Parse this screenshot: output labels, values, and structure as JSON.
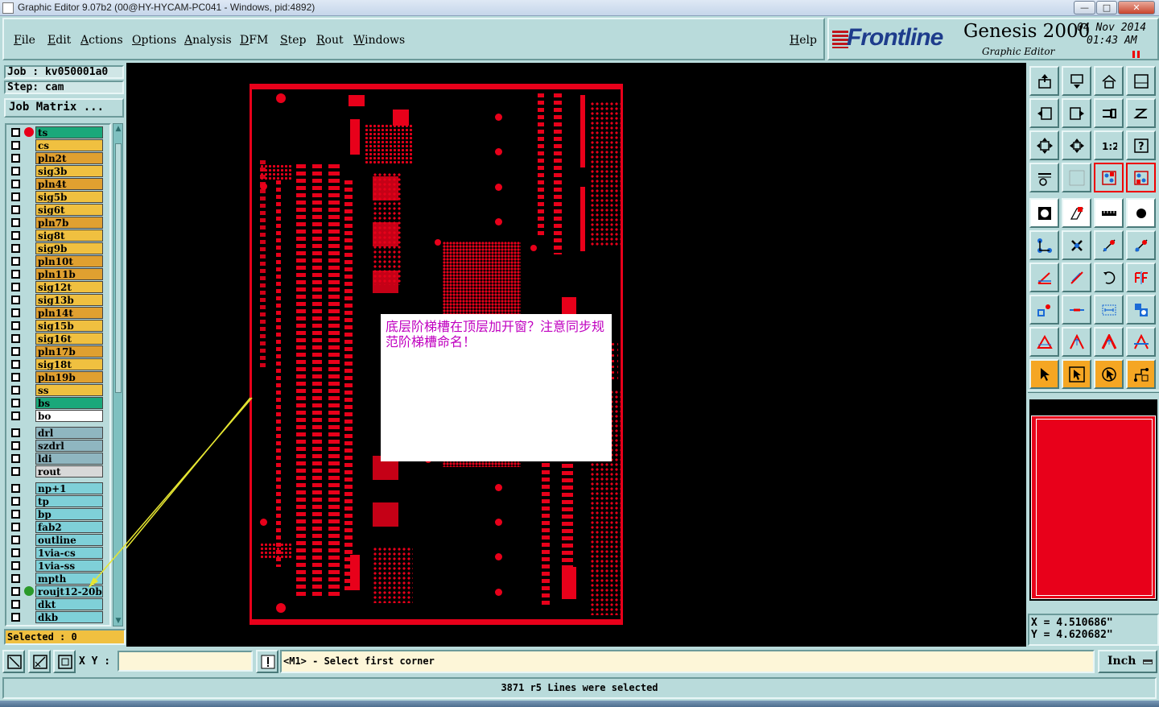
{
  "window": {
    "title": "Graphic Editor 9.07b2 (00@HY-HYCAM-PC041 - Windows, pid:4892)",
    "min_label": "—",
    "max_label": "□",
    "close_label": "✕"
  },
  "menu": {
    "items": [
      "File",
      "Edit",
      "Actions",
      "Options",
      "Analysis",
      "DFM",
      "Step",
      "Rout",
      "Windows"
    ],
    "help": "Help"
  },
  "logo": {
    "brand": "Frontline",
    "product": "Genesis 2000",
    "subtitle": "Graphic Editor",
    "date": "04 Nov 2014",
    "time": "01:43 AM"
  },
  "job": {
    "job_label": "Job : kv050001a0",
    "step_label": "Step: cam",
    "matrix_button": "Job Matrix ..."
  },
  "layers": [
    {
      "name": "ts",
      "color": "#1aa87a",
      "dot": "#e8001a"
    },
    {
      "name": "cs",
      "color": "#f0c040"
    },
    {
      "name": "pln2t",
      "color": "#e0a030"
    },
    {
      "name": "sig3b",
      "color": "#f0c040"
    },
    {
      "name": "pln4t",
      "color": "#e0a030"
    },
    {
      "name": "sig5b",
      "color": "#f0c040"
    },
    {
      "name": "sig6t",
      "color": "#f0c040"
    },
    {
      "name": "pln7b",
      "color": "#e0a030"
    },
    {
      "name": "sig8t",
      "color": "#f0c040"
    },
    {
      "name": "sig9b",
      "color": "#f0c040"
    },
    {
      "name": "pln10t",
      "color": "#e0a030"
    },
    {
      "name": "pln11b",
      "color": "#e0a030"
    },
    {
      "name": "sig12t",
      "color": "#f0c040"
    },
    {
      "name": "sig13b",
      "color": "#f0c040"
    },
    {
      "name": "pln14t",
      "color": "#e0a030"
    },
    {
      "name": "sig15b",
      "color": "#f0c040"
    },
    {
      "name": "sig16t",
      "color": "#f0c040"
    },
    {
      "name": "pln17b",
      "color": "#e0a030"
    },
    {
      "name": "sig18t",
      "color": "#f0c040"
    },
    {
      "name": "pln19b",
      "color": "#e0a030"
    },
    {
      "name": "ss",
      "color": "#f0c040"
    },
    {
      "name": "bs",
      "color": "#1aa87a"
    },
    {
      "name": "bo",
      "color": "#ffffff"
    },
    {
      "name": "drl",
      "color": "#8fb6c0",
      "gap": true
    },
    {
      "name": "szdrl",
      "color": "#8fb6c0"
    },
    {
      "name": "ldi",
      "color": "#8fb6c0"
    },
    {
      "name": "rout",
      "color": "#d8d8d8"
    },
    {
      "name": "np+1",
      "color": "#7fd0d8",
      "gap": true
    },
    {
      "name": "tp",
      "color": "#7fd0d8"
    },
    {
      "name": "bp",
      "color": "#7fd0d8"
    },
    {
      "name": "fab2",
      "color": "#7fd0d8"
    },
    {
      "name": "outline",
      "color": "#7fd0d8"
    },
    {
      "name": "1via-cs",
      "color": "#7fd0d8"
    },
    {
      "name": "1via-ss",
      "color": "#7fd0d8"
    },
    {
      "name": "mpth",
      "color": "#7fd0d8"
    },
    {
      "name": "roujt12-20b",
      "color": "#7fd0d8",
      "dot": "#2a9a2a"
    },
    {
      "name": "dkt",
      "color": "#7fd0d8"
    },
    {
      "name": "dkb",
      "color": "#7fd0d8"
    }
  ],
  "selected": "Selected : 0",
  "note": {
    "text": "底层阶梯槽在顶层加开窗？注意同步规范阶梯槽命名！"
  },
  "coords": {
    "x": "X = 4.510686\"",
    "y": "Y = 4.620682\""
  },
  "bottom": {
    "xy_label": "X Y :",
    "xy_value": "",
    "prompt": "<M1> - Select first corner",
    "units": "Inch",
    "status": "3871 r5 Lines were selected"
  },
  "toolbar_icons": [
    "export-icon",
    "import-icon",
    "home-icon",
    "panel-icon",
    "back-icon",
    "forward-icon",
    "swap-icon",
    "snap-icon",
    "zoom-fit-icon",
    "zoom-center-icon",
    "scale-1-2-icon",
    "help-query-icon",
    "settings-icon",
    "grid-icon",
    "layers-red-icon",
    "layers-red2-icon",
    "pad-icon",
    "feature-icon",
    "ruler-icon",
    "dot-icon",
    "connect-icon",
    "cross-icon",
    "line-dot-icon",
    "line-dot2-icon",
    "angle-icon",
    "slash-icon",
    "rotate-icon",
    "mirror-icon",
    "shapes-icon",
    "dash-icon",
    "measure-icon",
    "cluster-icon",
    "triangle-icon",
    "triangle-up-icon",
    "triangle-bold-icon",
    "triangle-line-icon",
    "pointer-icon",
    "pointer-box-icon",
    "pointer-circle-icon",
    "route-icon"
  ]
}
